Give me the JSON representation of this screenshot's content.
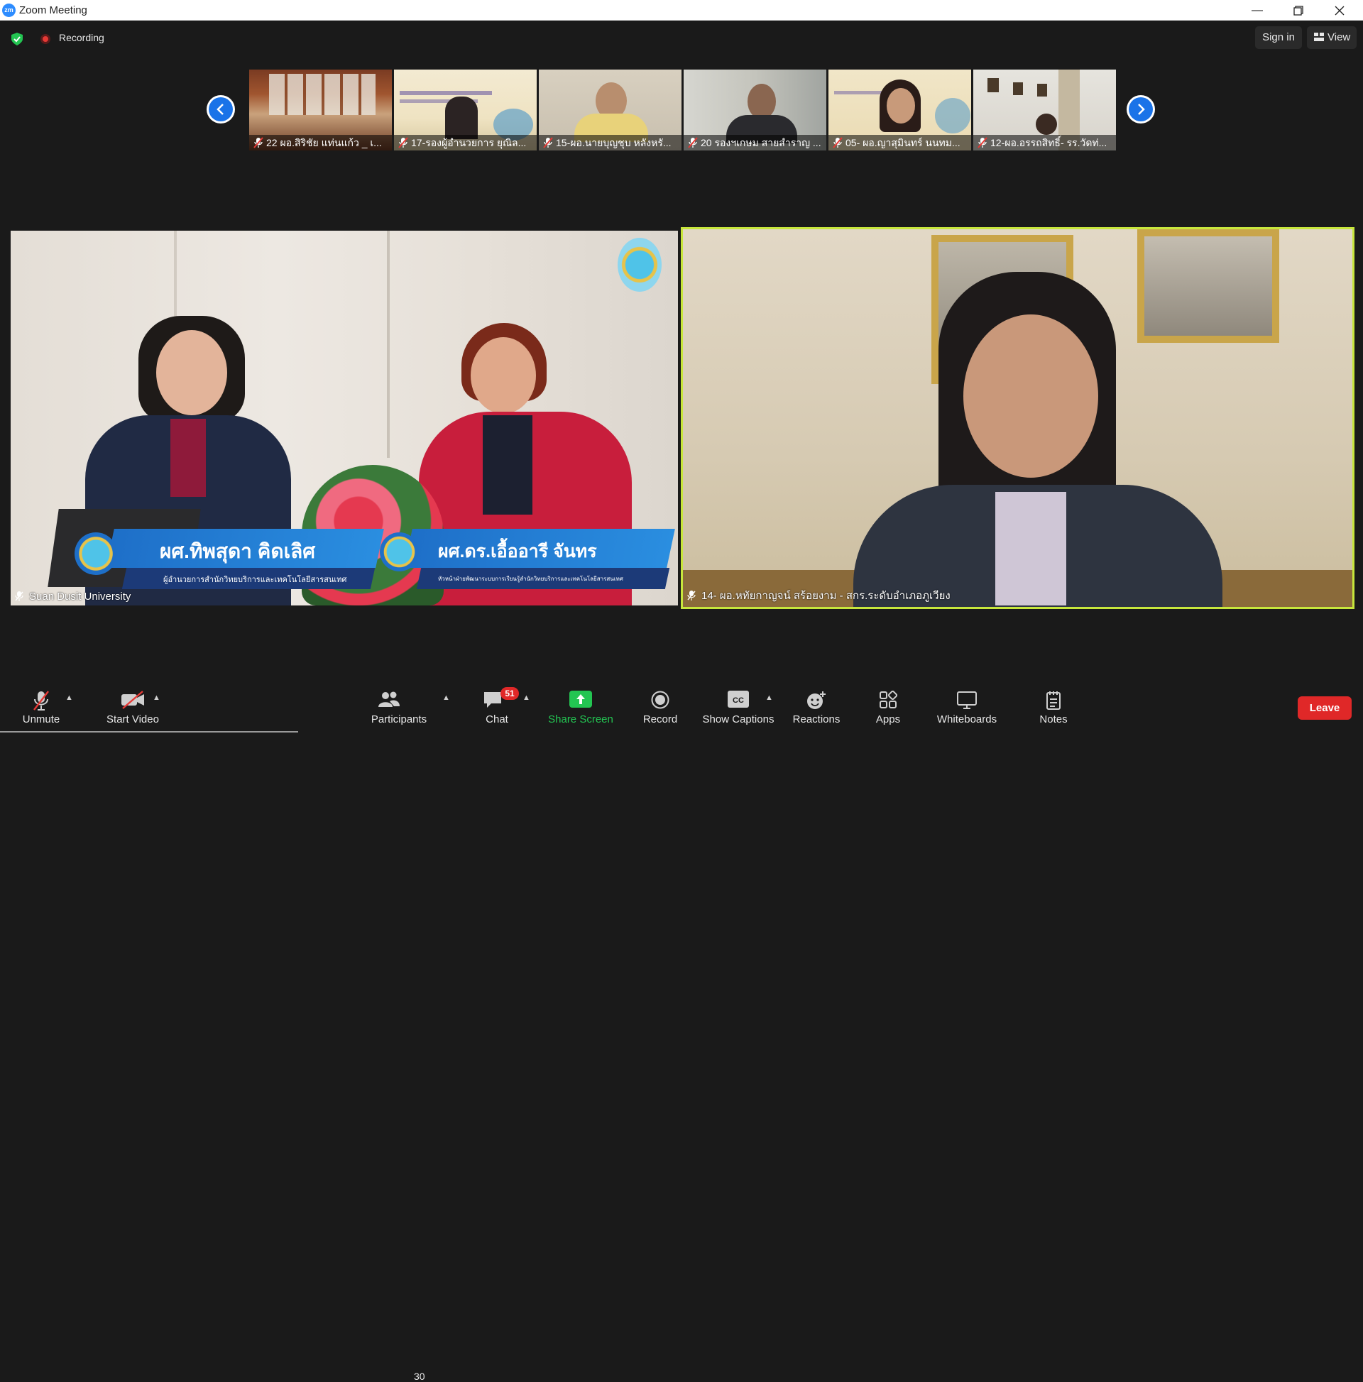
{
  "window": {
    "title": "Zoom Meeting",
    "app_icon_text": "zm"
  },
  "topbar": {
    "recording_label": "Recording",
    "sign_in": "Sign in",
    "view": "View"
  },
  "gallery": {
    "participants": [
      {
        "name": "22 ผอ.สิริชัย แท่นแก้ว _ เ...",
        "muted": true
      },
      {
        "name": "17-รองผู้อำนวยการ ยุณิล...",
        "muted": true
      },
      {
        "name": "15-ผอ.นายบุญชุบ หลังหรั...",
        "muted": true
      },
      {
        "name": "20 รองฯเกษม สายสำราญ ...",
        "muted": true
      },
      {
        "name": "05- ผอ.ญาสุมินทร์ นนทม...",
        "muted": true
      },
      {
        "name": "12-ผอ.อรรถสิทธิ์- รร.วัดท่...",
        "muted": true
      }
    ]
  },
  "main_tiles": {
    "left": {
      "name": "Suan Dusit University",
      "caption1_name": "ผศ.ทิพสุดา คิดเลิศ",
      "caption1_role": "ผู้อำนวยการสำนักวิทยบริการและเทคโนโลยีสารสนเทศ",
      "caption2_name": "ผศ.ดร.เอื้ออารี จันทร",
      "caption2_role": "หัวหน้าฝ่ายพัฒนาระบบการเรียนรู้สำนักวิทยบริการและเทคโนโลยีสารสนเทศ"
    },
    "right": {
      "name": "14- ผอ.หทัยกาญจน์ สร้อยงาม - สกร.ระดับอำเภอภูเวียง",
      "active_speaker": true
    }
  },
  "toolbar": {
    "unmute": "Unmute",
    "start_video": "Start Video",
    "participants": "Participants",
    "participants_count": "30",
    "chat": "Chat",
    "chat_badge": "51",
    "share_screen": "Share Screen",
    "record": "Record",
    "show_captions": "Show Captions",
    "reactions": "Reactions",
    "apps": "Apps",
    "whiteboards": "Whiteboards",
    "notes": "Notes",
    "leave": "Leave"
  },
  "colors": {
    "accent_blue": "#1a73e8",
    "share_green": "#23c552",
    "leave_red": "#e02828",
    "active_speaker_border": "#c7e63c"
  }
}
